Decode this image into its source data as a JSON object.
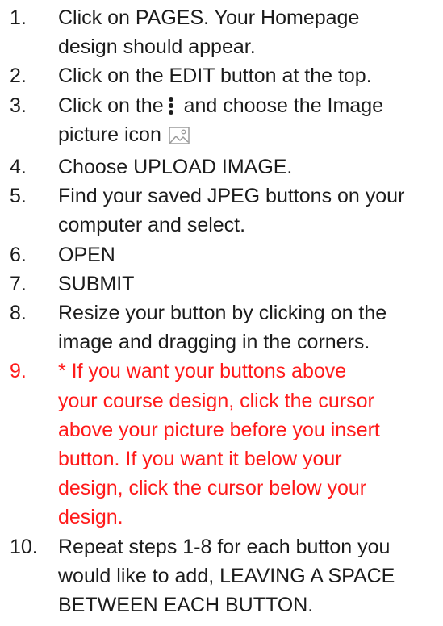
{
  "steps": [
    {
      "number": "1.",
      "lines": [
        "Click on PAGES.  Your Homepage",
        "design should appear."
      ]
    },
    {
      "number": "2.",
      "lines": [
        "Click on the EDIT button at the top."
      ]
    },
    {
      "number": "3.",
      "line1_before_icon": "Click on the",
      "line1_after_icon": "and choose the Image",
      "line2_before_icon": "picture icon",
      "icon_names": [
        "kebab-menu-icon",
        "image-icon"
      ]
    },
    {
      "number": "4.",
      "lines": [
        "Choose UPLOAD IMAGE."
      ]
    },
    {
      "number": "5.",
      "lines": [
        "Find your saved JPEG buttons on your",
        "computer and select."
      ]
    },
    {
      "number": "6.",
      "lines": [
        "OPEN"
      ]
    },
    {
      "number": "7.",
      "lines": [
        "SUBMIT"
      ]
    },
    {
      "number": "8.",
      "lines": [
        "Resize your button by clicking on the",
        "image and dragging in the corners."
      ]
    },
    {
      "number": "9.",
      "lines": [
        "* If you want your buttons above",
        "your course design, click the cursor",
        "above your picture before you insert",
        "button.  If you want it below your",
        "design, click the cursor below your",
        "design."
      ]
    },
    {
      "number": "10.",
      "lines": [
        "Repeat steps 1-8 for each button you",
        "would like to add, LEAVING A SPACE",
        "BETWEEN EACH BUTTON."
      ]
    }
  ],
  "colors": {
    "text": "#1c1c1c",
    "highlight": "#ff1a1a",
    "background": "#ffffff"
  }
}
